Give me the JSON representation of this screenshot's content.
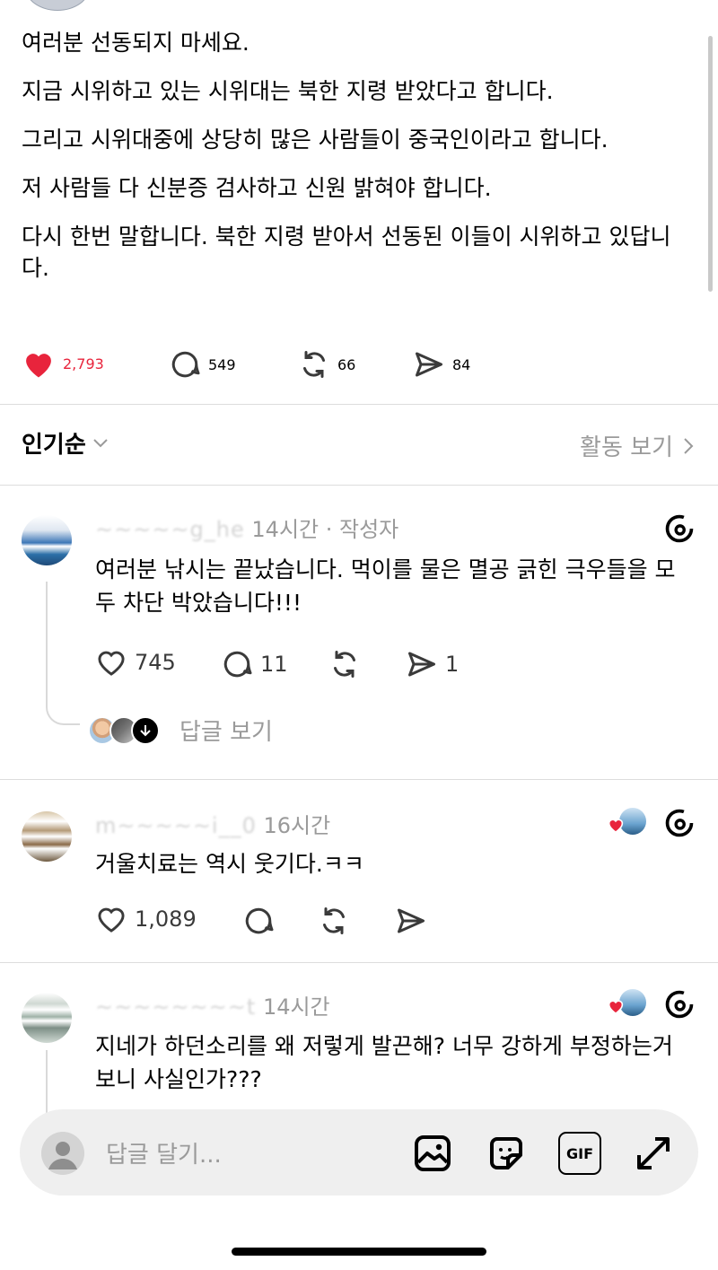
{
  "post": {
    "paragraphs": [
      "여러분 선동되지 마세요.",
      "지금 시위하고 있는 시위대는 북한 지령 받았다고 합니다.",
      "그리고 시위대중에 상당히 많은 사람들이 중국인이라고 합니다.",
      "저 사람들 다 신분증 검사하고 신원 밝혀야 합니다.",
      "다시 한번 말합니다. 북한 지령 받아서 선동된 이들이 시위하고 있답니다."
    ],
    "likes": "2,793",
    "comments": "549",
    "reposts": "66",
    "shares": "84"
  },
  "sort": {
    "label": "인기순",
    "activity_label": "활동 보기"
  },
  "comments": [
    {
      "name_obscured": "~~~~~g_he",
      "time": "14시간",
      "author_tag": " · 작성자",
      "text": "여러분 낚시는 끝났습니다. 먹이를 물은 멸공 긁힌 극우들을 모두 차단 박았습니다!!!",
      "likes": "745",
      "comments": "11",
      "shares": "1",
      "replies_label": "답글 보기"
    },
    {
      "name_obscured": "m~~~~~i__0",
      "time": "16시간",
      "text": "거울치료는 역시 웃기다.ㅋㅋ",
      "likes": "1,089"
    },
    {
      "name_obscured": "~~~~~~~~t",
      "time": "14시간",
      "text": "지네가 하던소리를 왜 저렇게 발끈해? 너무 강하게 부정하는거 보니 사실인가???"
    }
  ],
  "composer": {
    "placeholder": "답글 달기..."
  },
  "colors": {
    "like_red": "#e8243c",
    "secondary_text": "#9a9a9a"
  },
  "icons": [
    "heart-icon",
    "comment-icon",
    "repost-icon",
    "share-icon",
    "threads-logo-icon",
    "chevron-down-icon",
    "chevron-right-icon",
    "image-icon",
    "sticker-icon",
    "gif-icon",
    "expand-icon"
  ]
}
